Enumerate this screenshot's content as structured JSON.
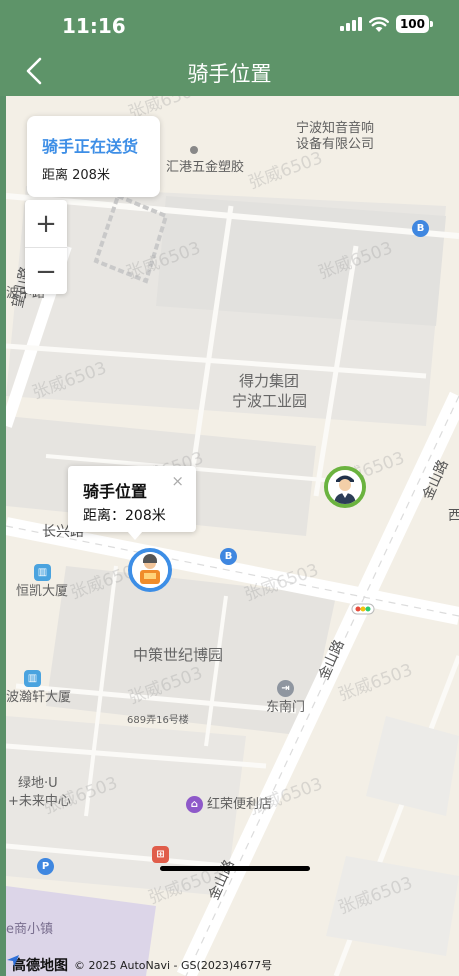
{
  "status_bar": {
    "time": "11:16",
    "battery": "100"
  },
  "header": {
    "title": "骑手位置"
  },
  "delivery_card": {
    "status": "骑手正在送货",
    "distance": "距离 208米"
  },
  "zoom": {
    "in": "+",
    "out": "−"
  },
  "rider_popup": {
    "title": "骑手位置",
    "distance": "距离：208米",
    "close": "×"
  },
  "map_labels": {
    "poi_1": "宁波知音音响",
    "poi_1_line2": "设备有限公司",
    "poi_2": "汇港五金塑胶",
    "poi_3": "得力集团",
    "poi_3_line2": "宁波工业园",
    "poi_4": "恒凯大厦",
    "poi_5": "中策世纪博园",
    "poi_6": "波瀚轩大厦",
    "poi_7": "东南门",
    "poi_8": "689弄16号楼",
    "poi_9": "绿地·U",
    "poi_9_line2": "+未来中心",
    "poi_10": "红荣便利店",
    "poi_11": "e商小镇",
    "road_1": "长兴路",
    "road_2": "望山路",
    "road_3": "金山路",
    "road_4": "金山路",
    "road_5": "金山路",
    "road_6": "西",
    "road_7": "波中路"
  },
  "watermark": "张威6503",
  "footer": {
    "logo": "高德地图",
    "copyright": "© 2025 AutoNavi - GS(2023)4677号"
  },
  "colors": {
    "header": "#5e9469",
    "accent": "#3d8ee6",
    "user_ring": "#6bb33f",
    "map_bg": "#f3efe6"
  }
}
